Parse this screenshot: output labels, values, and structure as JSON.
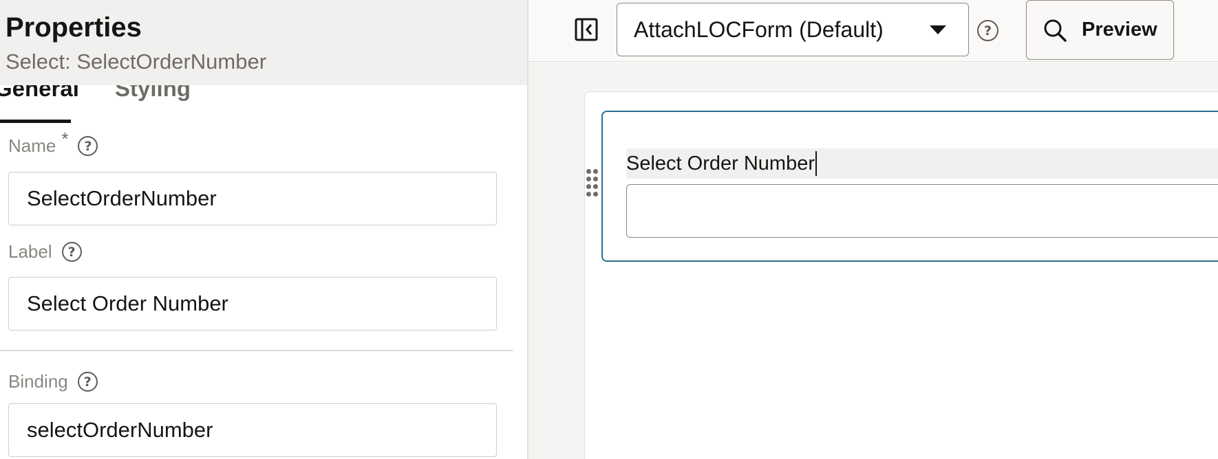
{
  "properties_panel": {
    "title": "Properties",
    "subtitle": "Select: SelectOrderNumber",
    "tabs": [
      {
        "label": "General",
        "active": true
      },
      {
        "label": "Styling",
        "active": false
      }
    ],
    "fields": {
      "name": {
        "label": "Name",
        "required_marker": "*",
        "value": "SelectOrderNumber"
      },
      "label": {
        "label": "Label",
        "value": "Select Order Number"
      },
      "binding": {
        "label": "Binding",
        "value": "selectOrderNumber"
      }
    }
  },
  "toolbar": {
    "panel_toggle_icon": "panel-collapse-left-icon",
    "form_select_value": "AttachLOCForm (Default)",
    "help_icon": "question-circle-icon",
    "preview_label": "Preview",
    "preview_icon": "search-icon"
  },
  "canvas": {
    "component_label": "Select Order Number",
    "component_value": "",
    "selection_color": "#2b6d8f"
  },
  "colors": {
    "header_bg": "#f1f0ee",
    "text_primary": "#161513",
    "text_muted": "#8a8782",
    "accent": "#2b6d8f"
  }
}
